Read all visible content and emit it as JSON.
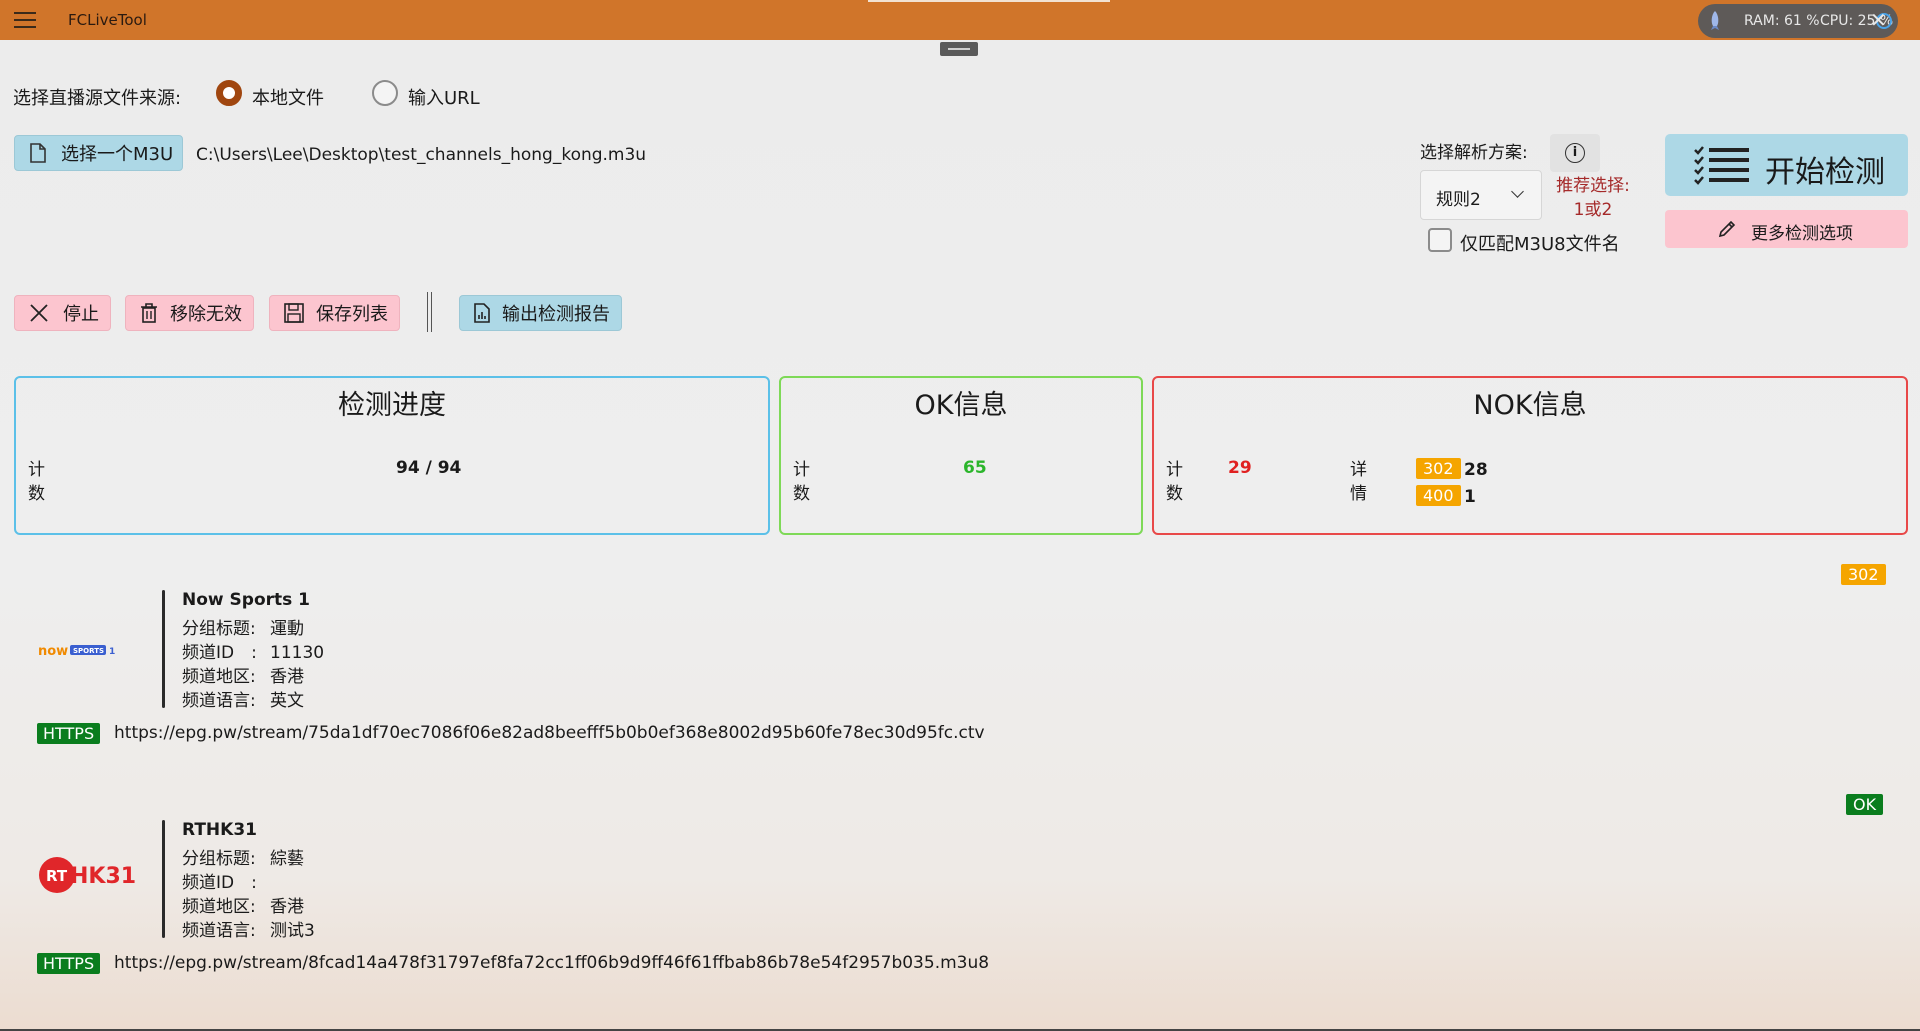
{
  "app": {
    "title": "FCLiveTool",
    "ram": "RAM: 61 %",
    "cpu": "CPU: 25 %"
  },
  "source": {
    "label": "选择直播源文件来源:",
    "options": [
      {
        "label": "本地文件",
        "checked": true
      },
      {
        "label": "输入URL",
        "checked": false
      }
    ]
  },
  "file": {
    "button_label": "选择一个M3U",
    "path": "C:\\Users\\Lee\\Desktop\\test_channels_hong_kong.m3u"
  },
  "scheme": {
    "label": "选择解析方案:",
    "selected": "规则2",
    "recommend_line1": "推荐选择:",
    "recommend_line2": "1或2",
    "match_only_m3u8": "仅匹配M3U8文件名",
    "match_only_checked": false
  },
  "actions": {
    "start": "开始检测",
    "more": "更多检测选项",
    "stop": "停止",
    "remove_invalid": "移除无效",
    "save_list": "保存列表",
    "export_report": "输出检测报告"
  },
  "progress_panel": {
    "title": "检测进度",
    "count_label_1": "计",
    "count_label_2": "数",
    "value": "94 / 94",
    "border_color": "#5bc0e8"
  },
  "ok_panel": {
    "title": "OK信息",
    "count_label_1": "计",
    "count_label_2": "数",
    "value": "65",
    "border_color": "#7ed957",
    "value_color": "#2bb52b"
  },
  "nok_panel": {
    "title": "NOK信息",
    "count_label_1": "计",
    "count_label_2": "数",
    "value": "29",
    "detail_label_1": "详",
    "detail_label_2": "情",
    "details": [
      {
        "code": "302",
        "count": "28"
      },
      {
        "code": "400",
        "count": "1"
      }
    ],
    "border_color": "#e84848",
    "value_color": "#e02020"
  },
  "channels": [
    {
      "logo": "now-sports-logo",
      "name": "Now Sports 1",
      "group_key": "分组标题:",
      "group": "運動",
      "id_key": "频道ID　:",
      "id": "11130",
      "region_key": "频道地区:",
      "region": "香港",
      "lang_key": "频道语言:",
      "lang": "英文",
      "protocol": "HTTPS",
      "url": "https://epg.pw/stream/75da1df70ec7086f06e82ad8beefff5b0b0ef368e8002d95b60fe78ec30d95fc.ctv",
      "status": "302"
    },
    {
      "logo": "rthk31-logo",
      "name": "RTHK31",
      "group_key": "分组标题:",
      "group": "綜藝",
      "id_key": "频道ID　:",
      "id": "",
      "region_key": "频道地区:",
      "region": "香港",
      "lang_key": "频道语言:",
      "lang": "测试3",
      "protocol": "HTTPS",
      "url": "https://epg.pw/stream/8fcad14a478f31797ef8fa72cc1ff06b9d9ff46f61ffbab86b78e54f2957b035.m3u8",
      "status": "OK"
    }
  ]
}
